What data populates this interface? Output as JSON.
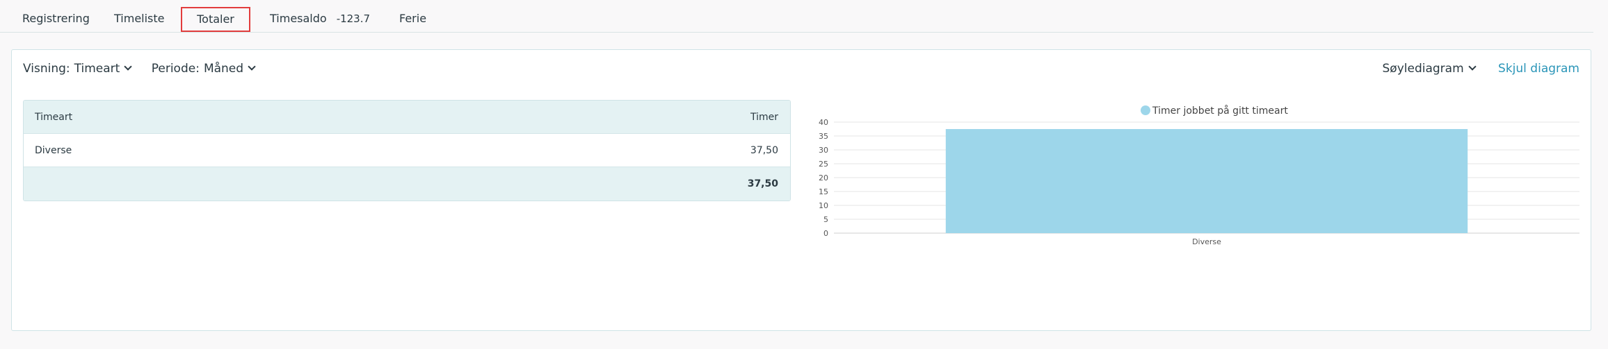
{
  "tabs": [
    {
      "label": "Registrering"
    },
    {
      "label": "Timeliste"
    },
    {
      "label": "Totaler"
    },
    {
      "label": "Timesaldo",
      "value": "-123.7"
    },
    {
      "label": "Ferie"
    }
  ],
  "filters": {
    "visning_label": "Visning:",
    "visning_value": "Timeart",
    "periode_label": "Periode:",
    "periode_value": "Måned"
  },
  "controls": {
    "chart_type": "Søylediagram",
    "hide_chart": "Skjul diagram"
  },
  "table": {
    "headers": [
      "Timeart",
      "Timer"
    ],
    "rows": [
      [
        "Diverse",
        "37,50"
      ]
    ],
    "total": "37,50"
  },
  "colors": {
    "bar": "#9dd6ea",
    "active_tab_border": "#e23c3c",
    "link": "#2a95b8"
  },
  "chart_data": {
    "type": "bar",
    "categories": [
      "Diverse"
    ],
    "series": [
      {
        "name": "Timer jobbet på gitt timeart",
        "values": [
          37.5
        ]
      }
    ],
    "ylim": [
      0,
      40
    ],
    "yticks": [
      0,
      5,
      10,
      15,
      20,
      25,
      30,
      35,
      40
    ],
    "grid": true,
    "legend": "top-center"
  }
}
